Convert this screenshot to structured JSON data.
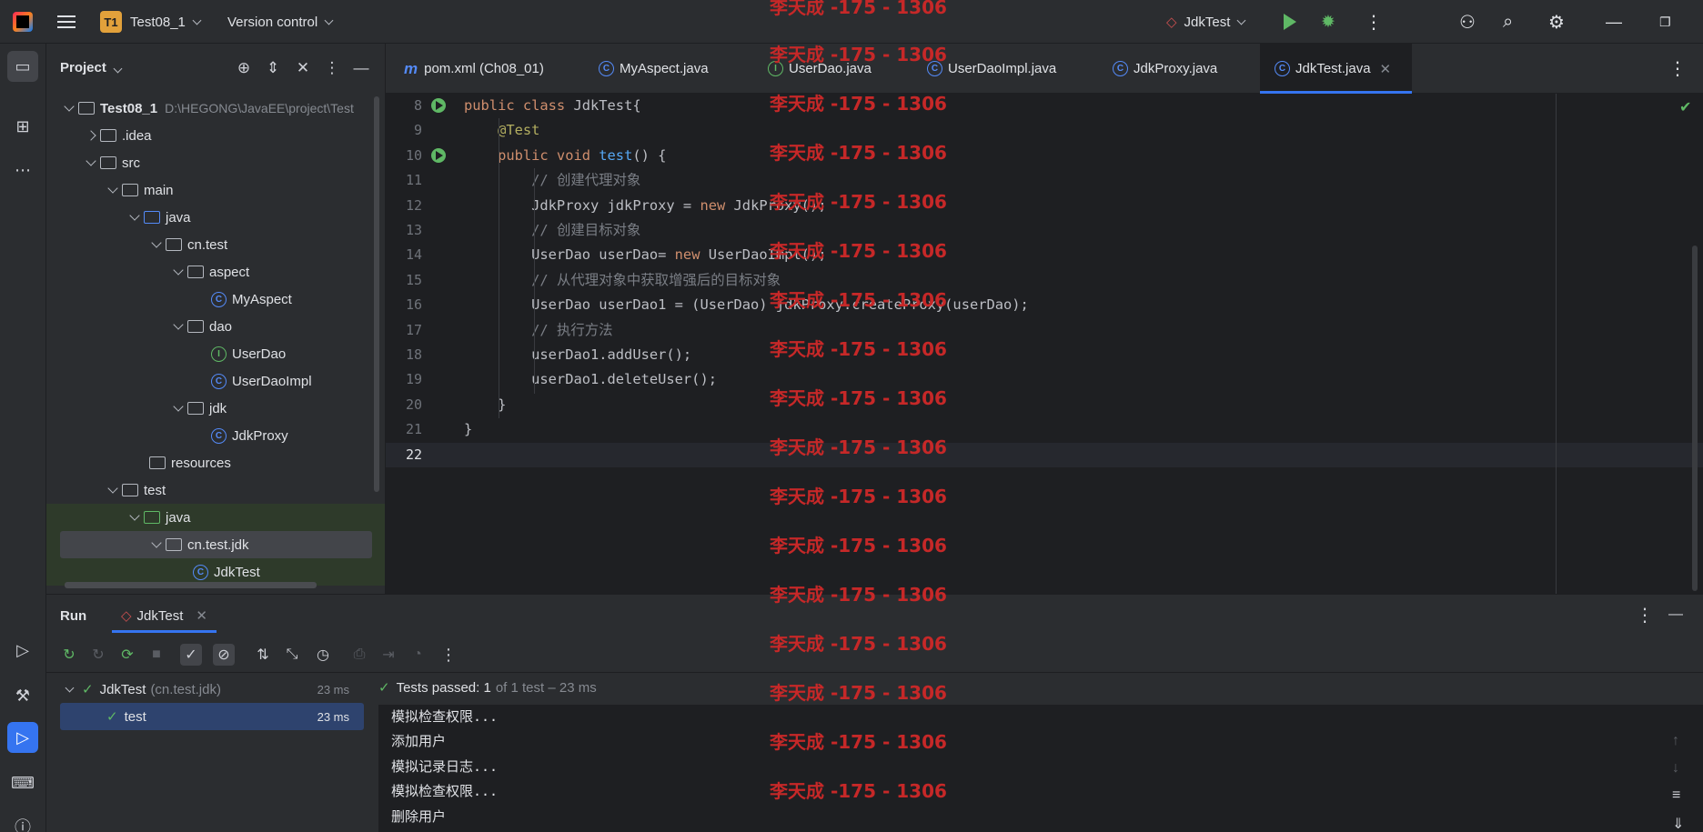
{
  "titlebar": {
    "project_badge": "T1",
    "project_name": "Test08_1",
    "version_control": "Version control",
    "run_config": "JdkTest"
  },
  "project_panel": {
    "title": "Project",
    "tree": [
      {
        "label": "Test08_1",
        "path": "D:\\HEGONG\\JavaEE\\project\\Test"
      },
      {
        "label": ".idea"
      },
      {
        "label": "src"
      },
      {
        "label": "main"
      },
      {
        "label": "java"
      },
      {
        "label": "cn.test"
      },
      {
        "label": "aspect"
      },
      {
        "label": "MyAspect"
      },
      {
        "label": "dao"
      },
      {
        "label": "UserDao"
      },
      {
        "label": "UserDaoImpl"
      },
      {
        "label": "jdk"
      },
      {
        "label": "JdkProxy"
      },
      {
        "label": "resources"
      },
      {
        "label": "test"
      },
      {
        "label": "java"
      },
      {
        "label": "cn.test.jdk"
      },
      {
        "label": "JdkTest"
      }
    ]
  },
  "editor": {
    "tabs": [
      {
        "label": "pom.xml (Ch08_01)"
      },
      {
        "label": "MyAspect.java"
      },
      {
        "label": "UserDao.java"
      },
      {
        "label": "UserDaoImpl.java"
      },
      {
        "label": "JdkProxy.java"
      },
      {
        "label": "JdkTest.java"
      }
    ],
    "line_numbers": [
      "8",
      "9",
      "10",
      "11",
      "12",
      "13",
      "14",
      "15",
      "16",
      "17",
      "18",
      "19",
      "20",
      "21",
      "22"
    ],
    "code": [
      {
        "a": "public class ",
        "b": "JdkTest{"
      },
      {
        "a": "    ",
        "b": "@Test"
      },
      {
        "a": "    public void ",
        "b": "test",
        "c": "() {"
      },
      {
        "a": "        ",
        "b": "// 创建代理对象"
      },
      {
        "a": "        JdkProxy jdkProxy = ",
        "b": "new ",
        "c": "JdkProxy();"
      },
      {
        "a": "        ",
        "b": "// 创建目标对象"
      },
      {
        "a": "        UserDao userDao= ",
        "b": "new ",
        "c": "UserDaoImpl();"
      },
      {
        "a": "        ",
        "b": "// 从代理对象中获取增强后的目标对象"
      },
      {
        "a": "        UserDao userDao1 = (UserDao) jdkProxy.createProxy(userDao);"
      },
      {
        "a": "        ",
        "b": "// 执行方法"
      },
      {
        "a": "        userDao1.addUser();"
      },
      {
        "a": "        userDao1.deleteUser();"
      },
      {
        "a": "    }"
      },
      {
        "a": "}"
      },
      {
        "a": ""
      }
    ]
  },
  "run_panel": {
    "title": "Run",
    "tab": "JdkTest",
    "tests": [
      {
        "name": "JdkTest",
        "detail": "(cn.test.jdk)",
        "time": "23 ms"
      },
      {
        "name": "test",
        "time": "23 ms"
      }
    ],
    "status_bold": "Tests passed: 1",
    "status_rest": "of 1 test – 23 ms",
    "console": [
      "模拟检查权限...",
      "添加用户",
      "模拟记录日志...",
      "模拟检查权限...",
      "删除用户"
    ]
  },
  "watermark": "李天成 -175 - 1306",
  "colors": {
    "accent": "#3574f0",
    "success": "#5fb865",
    "watermark": "#c62828",
    "keyword": "#cf8e6d",
    "function": "#56a8f5",
    "annotation": "#b3ae60"
  }
}
